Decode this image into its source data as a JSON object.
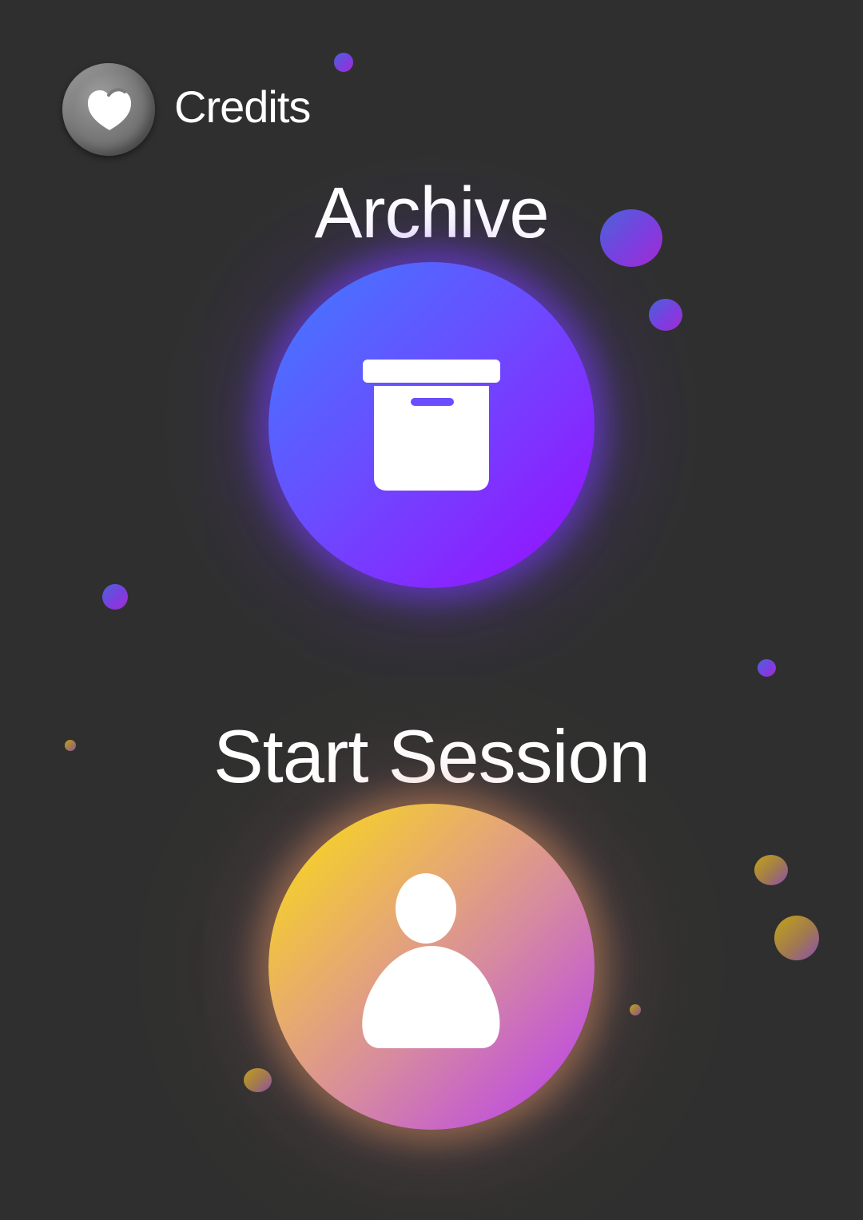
{
  "credits": {
    "label": "Credits",
    "icon": "heart-icon"
  },
  "archive": {
    "title": "Archive",
    "icon": "archive-box-icon"
  },
  "session": {
    "title": "Start Session",
    "icon": "user-icon"
  },
  "colors": {
    "background": "#2f2f2f",
    "archive_gradient": [
      "#3f7cff",
      "#9a0cff"
    ],
    "session_gradient": [
      "#fbe00c",
      "#b73af4"
    ]
  }
}
